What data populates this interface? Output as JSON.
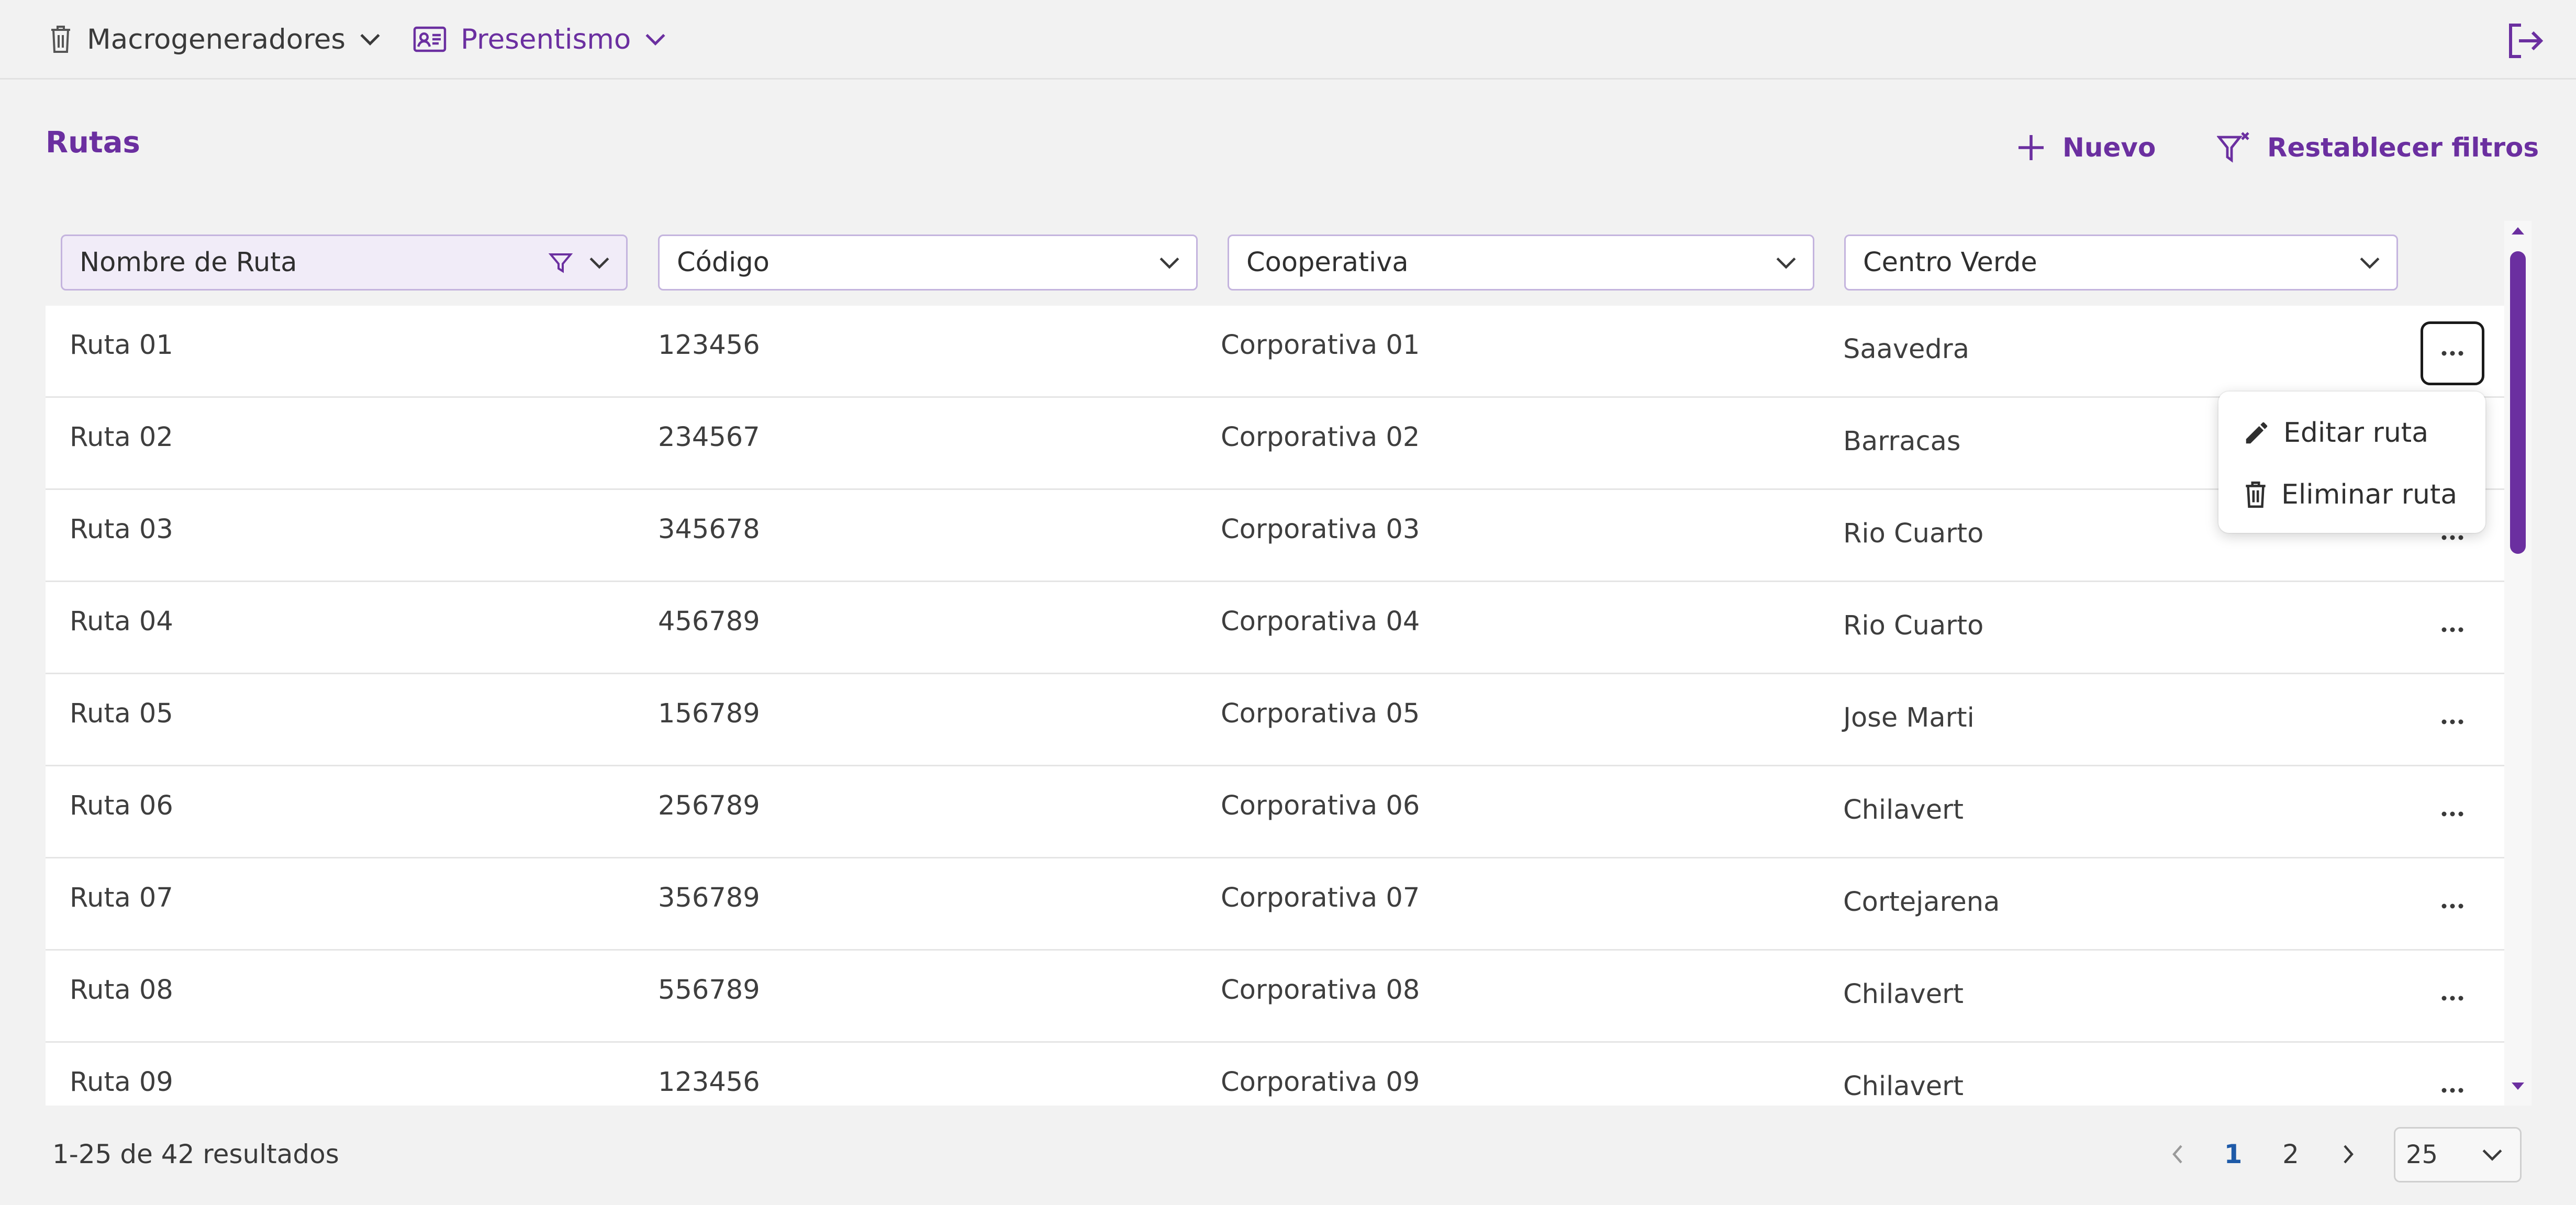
{
  "nav": {
    "macro_label": "Macrogeneradores",
    "presentismo_label": "Presentismo"
  },
  "page": {
    "title": "Rutas",
    "new_label": "Nuevo",
    "reset_filters_label": "Restablecer filtros"
  },
  "filters": [
    {
      "label": "Nombre de Ruta"
    },
    {
      "label": "Código"
    },
    {
      "label": "Cooperativa"
    },
    {
      "label": "Centro Verde"
    }
  ],
  "rows": [
    {
      "name": "Ruta 01",
      "code": "123456",
      "coop": "Corporativa 01",
      "center": "Saavedra"
    },
    {
      "name": "Ruta 02",
      "code": "234567",
      "coop": "Corporativa 02",
      "center": "Barracas"
    },
    {
      "name": "Ruta 03",
      "code": "345678",
      "coop": "Corporativa 03",
      "center": "Rio Cuarto"
    },
    {
      "name": "Ruta 04",
      "code": "456789",
      "coop": "Corporativa 04",
      "center": "Rio Cuarto"
    },
    {
      "name": "Ruta 05",
      "code": "156789",
      "coop": "Corporativa 05",
      "center": "Jose Marti"
    },
    {
      "name": "Ruta 06",
      "code": "256789",
      "coop": "Corporativa 06",
      "center": "Chilavert"
    },
    {
      "name": "Ruta 07",
      "code": "356789",
      "coop": "Corporativa 07",
      "center": "Cortejarena"
    },
    {
      "name": "Ruta 08",
      "code": "556789",
      "coop": "Corporativa 08",
      "center": "Chilavert"
    },
    {
      "name": "Ruta 09",
      "code": "123456",
      "coop": "Corporativa 09",
      "center": "Chilavert"
    }
  ],
  "row_menu": {
    "edit_label": "Editar ruta",
    "delete_label": "Eliminar ruta"
  },
  "footer": {
    "results": "1-25 de 42 resultados",
    "pages": [
      "1",
      "2"
    ],
    "current_page": "1",
    "page_size": "25"
  },
  "colors": {
    "accent": "#6b2fa0",
    "active_page": "#1e5aa8"
  }
}
